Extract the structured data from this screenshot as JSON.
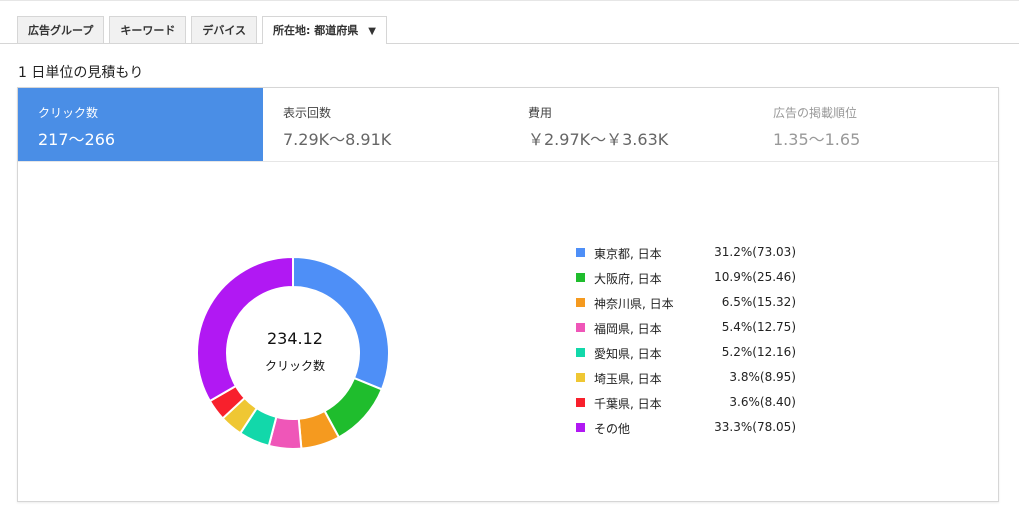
{
  "tabs": [
    {
      "label": "広告グループ"
    },
    {
      "label": "キーワード"
    },
    {
      "label": "デバイス"
    },
    {
      "label": "所在地: 都道府県",
      "active": true,
      "caret": "▼"
    }
  ],
  "section_title": "1 日単位の見積もり",
  "metrics": [
    {
      "label": "クリック数",
      "value": "217〜266",
      "active": true
    },
    {
      "label": "表示回数",
      "value": "7.29K〜8.91K"
    },
    {
      "label": "費用",
      "value": "￥2.97K〜￥3.63K"
    },
    {
      "label": "広告の掲載順位",
      "value": "1.35〜1.65",
      "dim": true
    }
  ],
  "center": {
    "value": "234.12",
    "label": "クリック数"
  },
  "chart_data": {
    "type": "pie",
    "donut": true,
    "center_value": 234.12,
    "center_label": "クリック数",
    "legend_position": "right",
    "slices": [
      {
        "name": "東京都, 日本",
        "percent": 31.2,
        "value": 73.03,
        "display": "31.2%(73.03)",
        "color": "#4e8ff7"
      },
      {
        "name": "大阪府, 日本",
        "percent": 10.9,
        "value": 25.46,
        "display": "10.9%(25.46)",
        "color": "#1fbd2d"
      },
      {
        "name": "神奈川県, 日本",
        "percent": 6.5,
        "value": 15.32,
        "display": "6.5%(15.32)",
        "color": "#f59a1f"
      },
      {
        "name": "福岡県, 日本",
        "percent": 5.4,
        "value": 12.75,
        "display": "5.4%(12.75)",
        "color": "#ef56b8"
      },
      {
        "name": "愛知県, 日本",
        "percent": 5.2,
        "value": 12.16,
        "display": "5.2%(12.16)",
        "color": "#12d8aa"
      },
      {
        "name": "埼玉県, 日本",
        "percent": 3.8,
        "value": 8.95,
        "display": "3.8%(8.95)",
        "color": "#efc733"
      },
      {
        "name": "千葉県, 日本",
        "percent": 3.6,
        "value": 8.4,
        "display": "3.6%(8.40)",
        "color": "#f8202c"
      },
      {
        "name": "その他",
        "percent": 33.3,
        "value": 78.05,
        "display": "33.3%(78.05)",
        "color": "#b118f3"
      }
    ]
  }
}
